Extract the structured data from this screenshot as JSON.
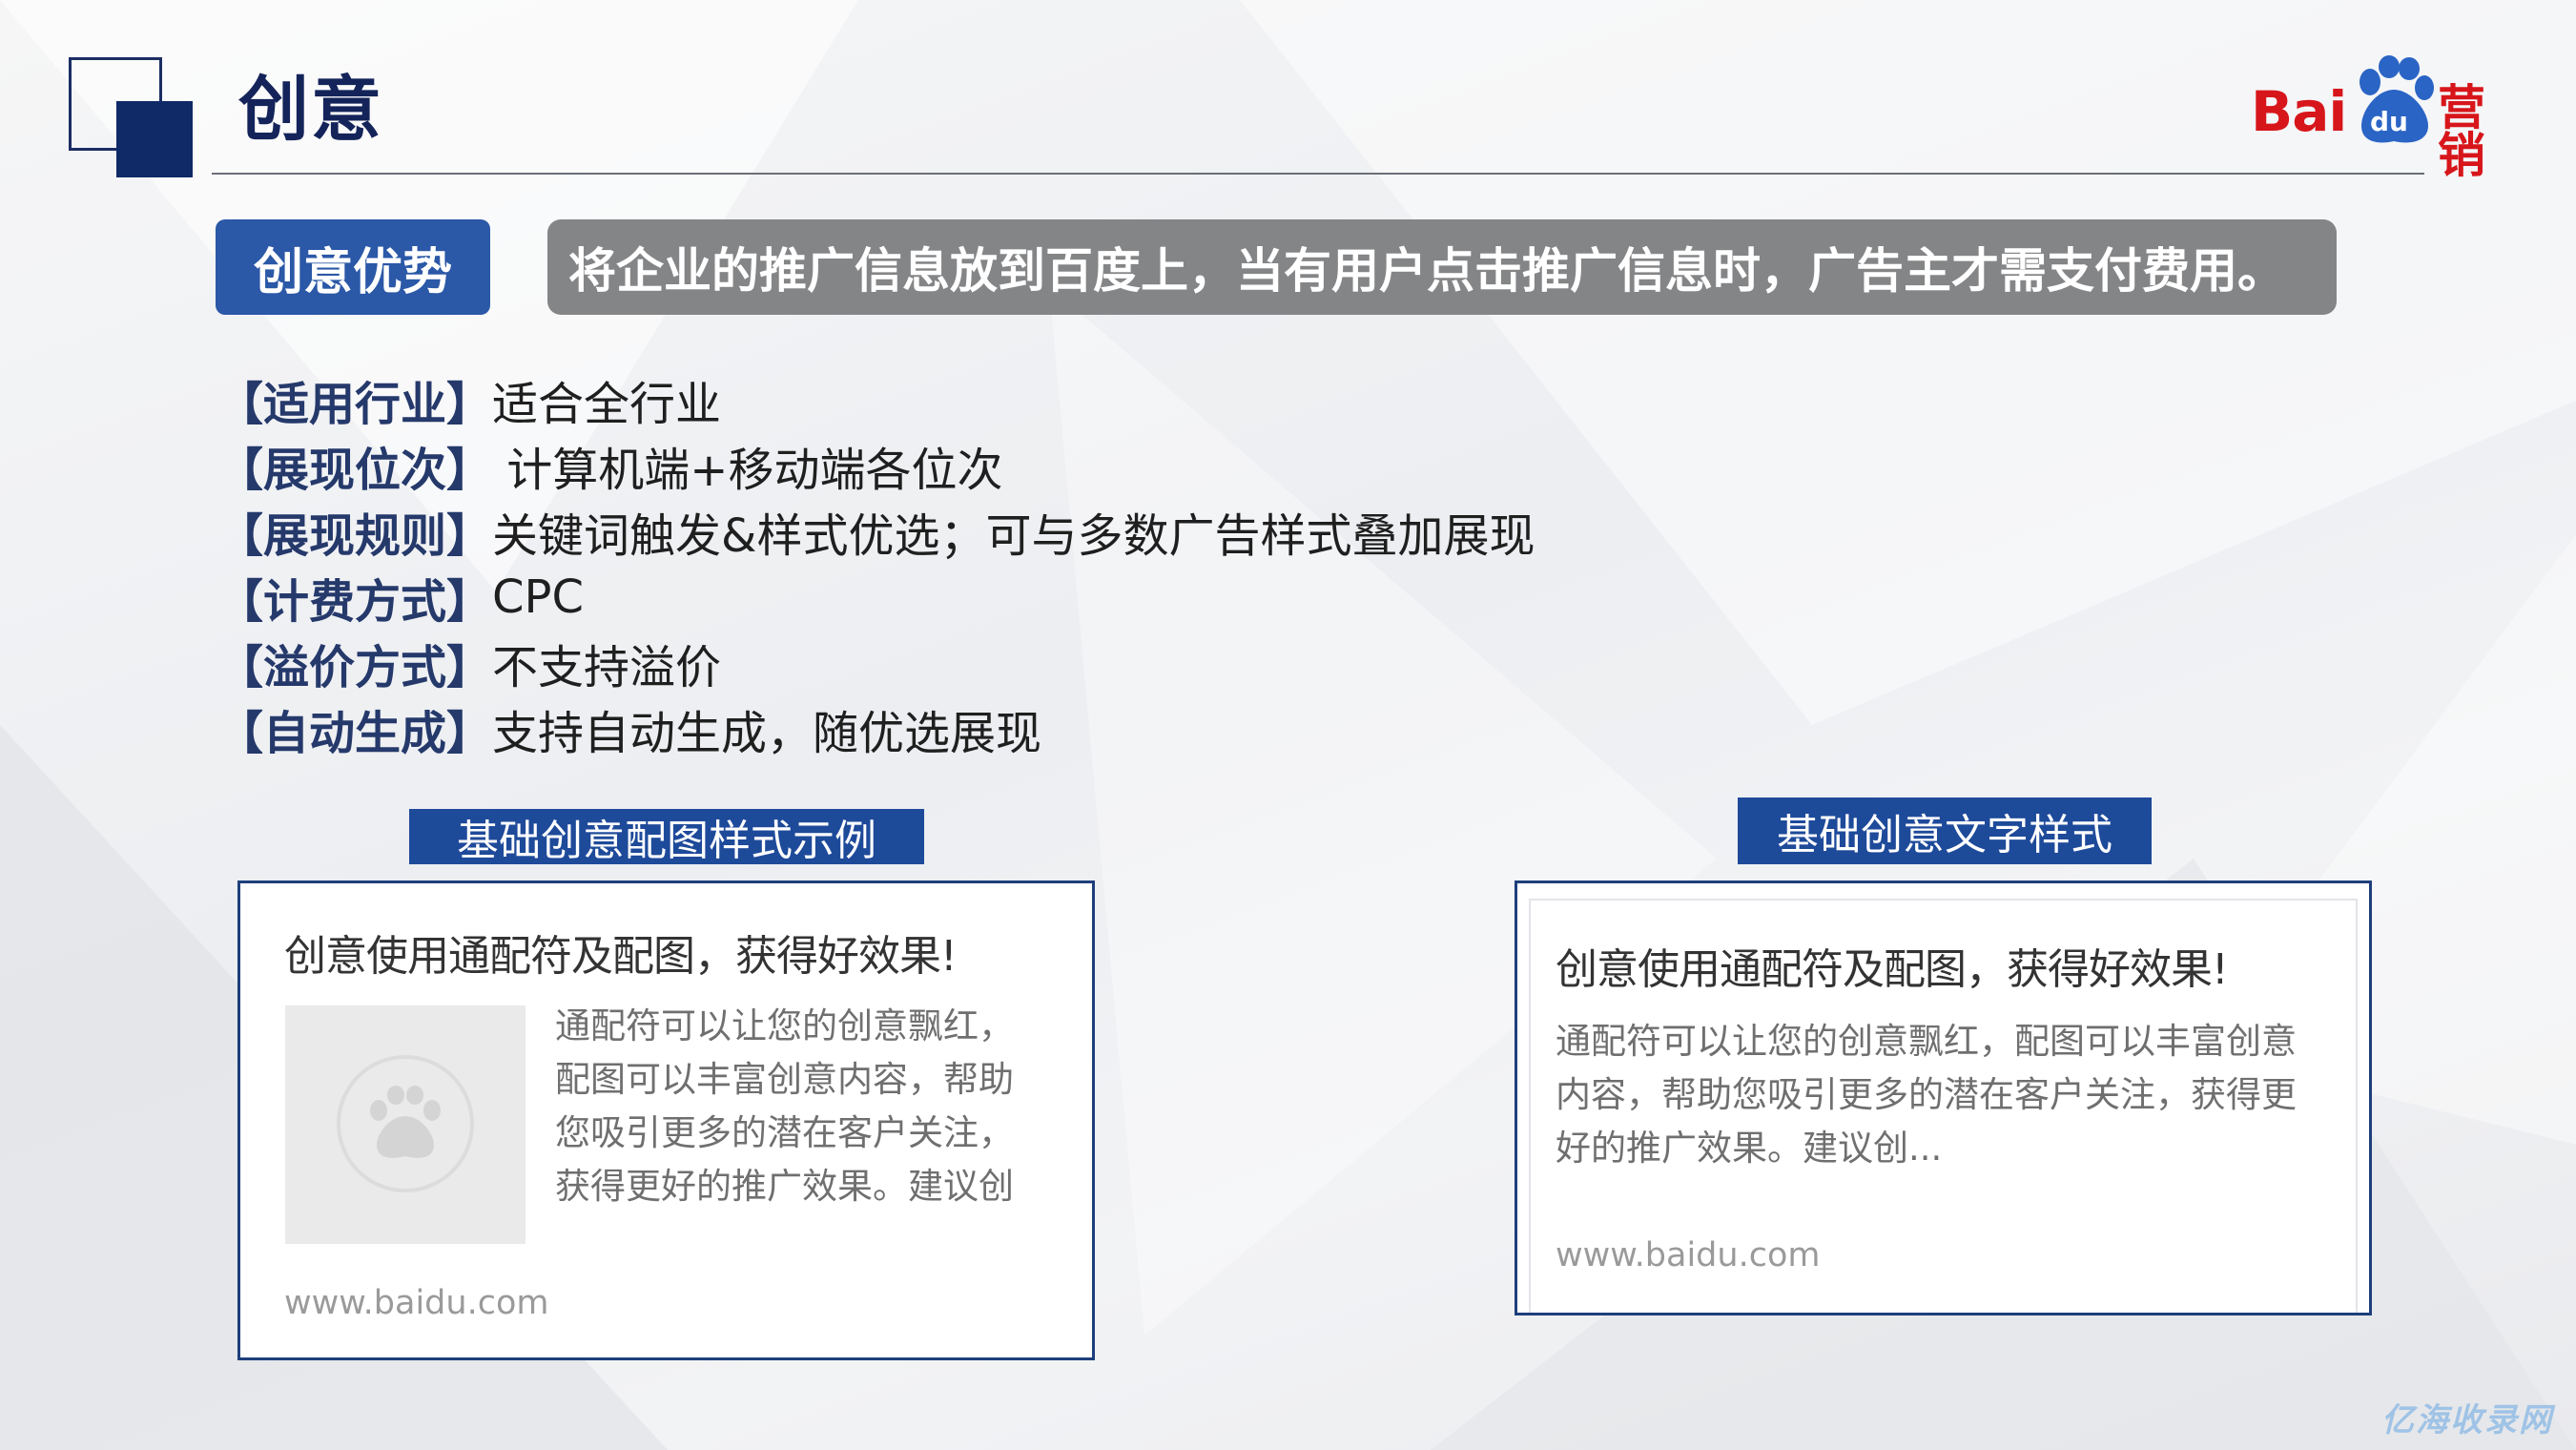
{
  "header": {
    "title": "创意",
    "logo": {
      "text_bai": "Bai",
      "text_du": "du",
      "text_yingxiao": "营销",
      "brand_color": "#d7161b"
    }
  },
  "advantage": {
    "label": "创意优势",
    "description": "将企业的推广信息放到百度上，当有用户点击推广信息时，广告主才需支付费用。"
  },
  "features": [
    {
      "key": "【适用行业】",
      "value": "适合全行业"
    },
    {
      "key": "【展现位次】",
      "value": " 计算机端+移动端各位次"
    },
    {
      "key": "【展现规则】",
      "value": "关键词触发&样式优选；可与多数广告样式叠加展现"
    },
    {
      "key": "【计费方式】",
      "value": "CPC"
    },
    {
      "key": "【溢价方式】",
      "value": "不支持溢价"
    },
    {
      "key": "【自动生成】",
      "value": "支持自动生成，随优选展现"
    }
  ],
  "examples": {
    "image_style": {
      "header": "基础创意配图样式示例",
      "ad_title": "创意使用通配符及配图，获得好效果!",
      "ad_desc_lines": [
        "通配符可以让您的创意飘红，",
        "配图可以丰富创意内容，帮助",
        "您吸引更多的潜在客户关注，",
        "获得更好的推广效果。建议创"
      ],
      "ad_url": "www.baidu.com",
      "thumbnail_icon": "baidu-paw-icon"
    },
    "text_style": {
      "header": "基础创意文字样式",
      "ad_title": "创意使用通配符及配图，获得好效果!",
      "ad_desc_lines": [
        "通配符可以让您的创意飘红，配图可以丰富创意",
        "内容，帮助您吸引更多的潜在客户关注，获得更",
        "好的推广效果。建议创..."
      ],
      "ad_url": "www.baidu.com"
    }
  },
  "watermark": "亿海收录网",
  "colors": {
    "navy": "#14245a",
    "accent_blue": "#2b58a7",
    "banner_gray": "#848587"
  }
}
